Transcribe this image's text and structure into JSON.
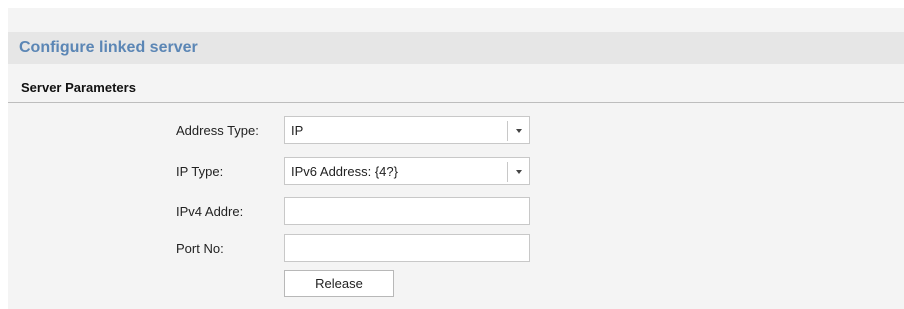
{
  "header": {
    "title": "Configure linked server"
  },
  "section": {
    "title": "Server Parameters"
  },
  "form": {
    "address_type": {
      "label": "Address Type:",
      "value": "IP"
    },
    "ip_type": {
      "label": "IP Type:",
      "value": "IPv6 Address: {4?}"
    },
    "ipv4_address": {
      "label": "IPv4 Addre:",
      "value": ""
    },
    "port_no": {
      "label": "Port No:",
      "value": ""
    }
  },
  "actions": {
    "release_label": "Release"
  },
  "icons": {
    "dropdown": "chevron-down-icon"
  }
}
